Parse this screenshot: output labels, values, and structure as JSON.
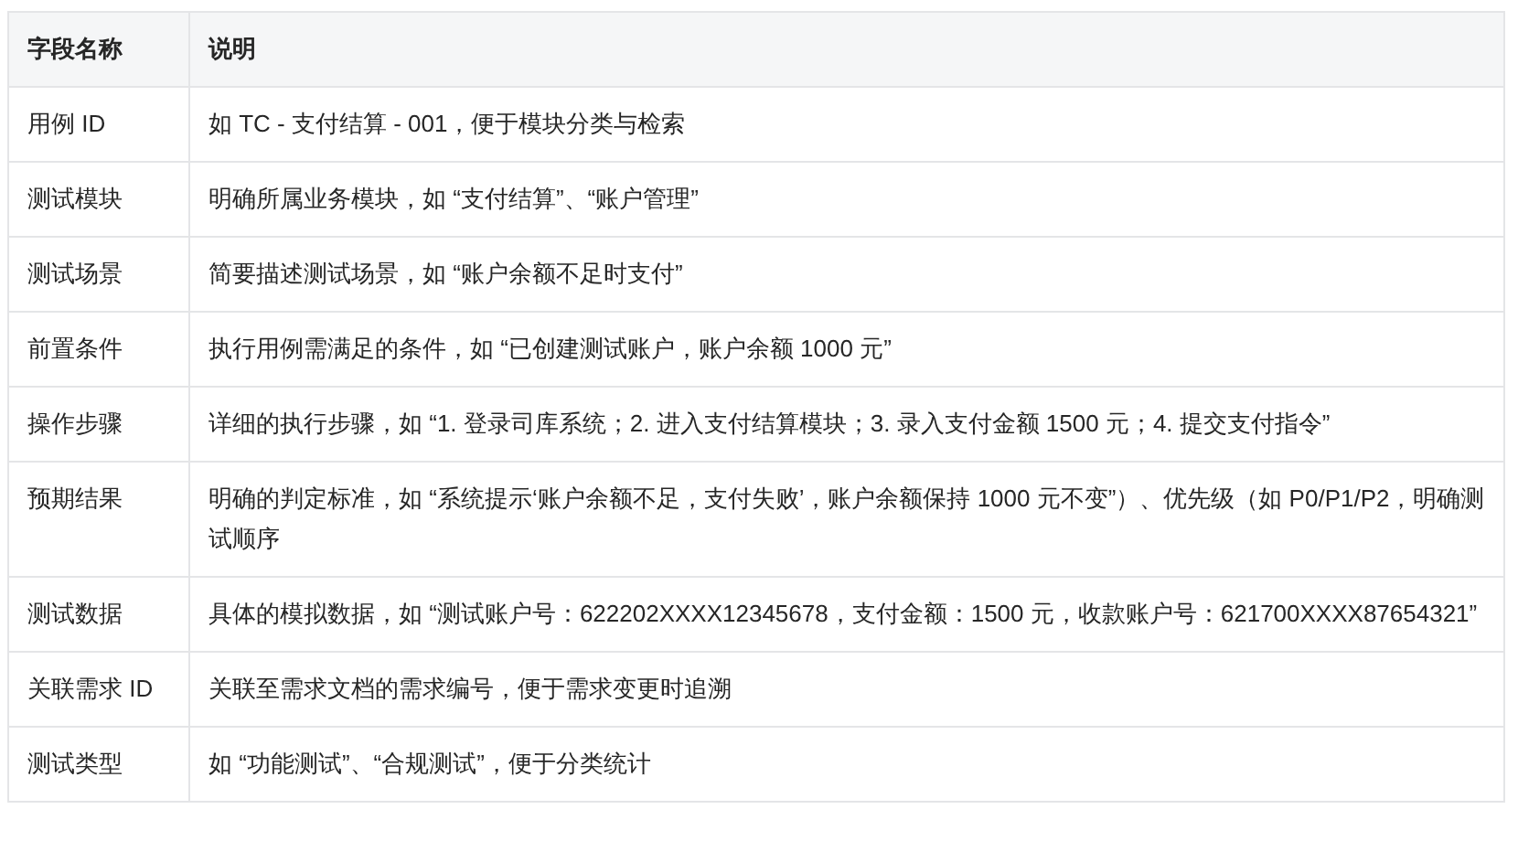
{
  "table": {
    "columns": [
      "字段名称",
      "说明"
    ],
    "rows": [
      [
        "用例 ID",
        "如 TC - 支付结算 - 001，便于模块分类与检索"
      ],
      [
        "测试模块",
        "明确所属业务模块，如 “支付结算”、“账户管理”"
      ],
      [
        "测试场景",
        "简要描述测试场景，如 “账户余额不足时支付”"
      ],
      [
        "前置条件",
        "执行用例需满足的条件，如 “已创建测试账户，账户余额 1000 元”"
      ],
      [
        "操作步骤",
        "详细的执行步骤，如 “1. 登录司库系统；2. 进入支付结算模块；3. 录入支付金额 1500 元；4. 提交支付指令”"
      ],
      [
        "预期结果",
        "明确的判定标准，如 “系统提示‘账户余额不足，支付失败’，账户余额保持 1000 元不变”）、优先级（如 P0/P1/P2，明确测试顺序"
      ],
      [
        "测试数据",
        "具体的模拟数据，如 “测试账户号：622202XXXX12345678，支付金额：1500 元，收款账户号：621700XXXX87654321”"
      ],
      [
        "关联需求 ID",
        "关联至需求文档的需求编号，便于需求变更时追溯"
      ],
      [
        "测试类型",
        "如 “功能测试”、“合规测试”，便于分类统计"
      ]
    ]
  }
}
